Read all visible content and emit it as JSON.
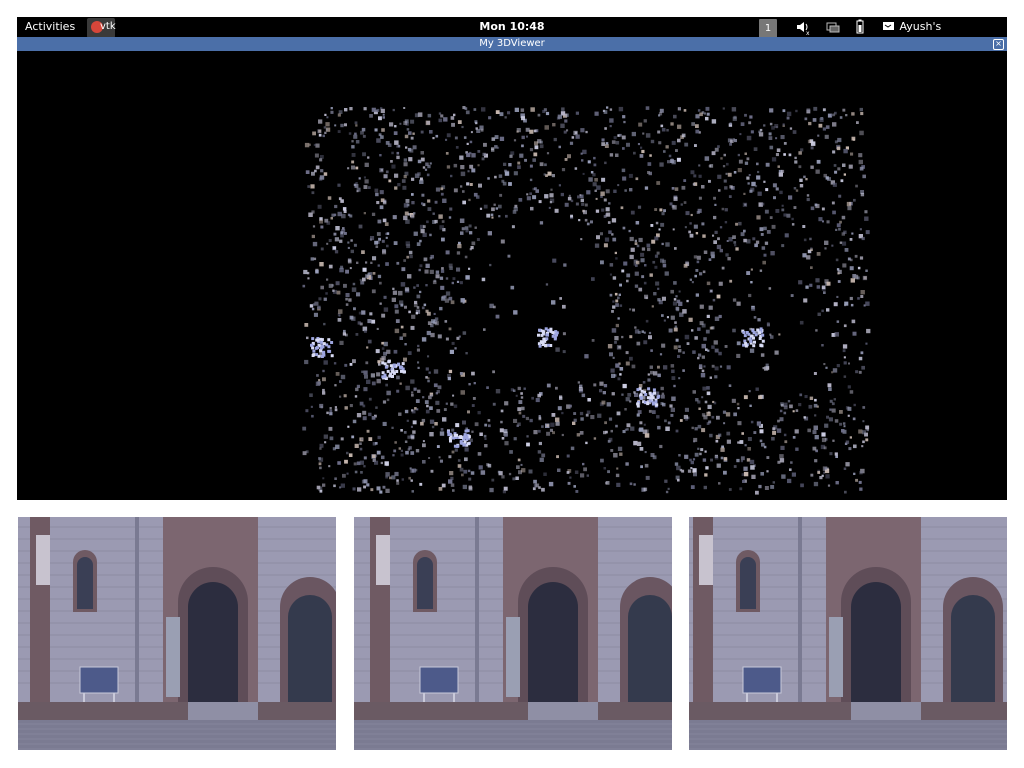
{
  "topbar": {
    "activities_label": "Activities",
    "app_label": "vtk",
    "clock": "Mon 10:48",
    "workspace_number": "1",
    "user_label": "Ayush's Workstation"
  },
  "window": {
    "title": "My 3DViewer",
    "close_glyph": "×"
  },
  "viewport": {
    "content": "3D point cloud reconstruction of church facade"
  },
  "colors": {
    "topbar_bg": "#000000",
    "titlebar_bg": "#4b6fa8",
    "viewport_bg": "#000000"
  },
  "icons": [
    "volume-icon",
    "network-icon",
    "battery-icon",
    "user-icon"
  ]
}
